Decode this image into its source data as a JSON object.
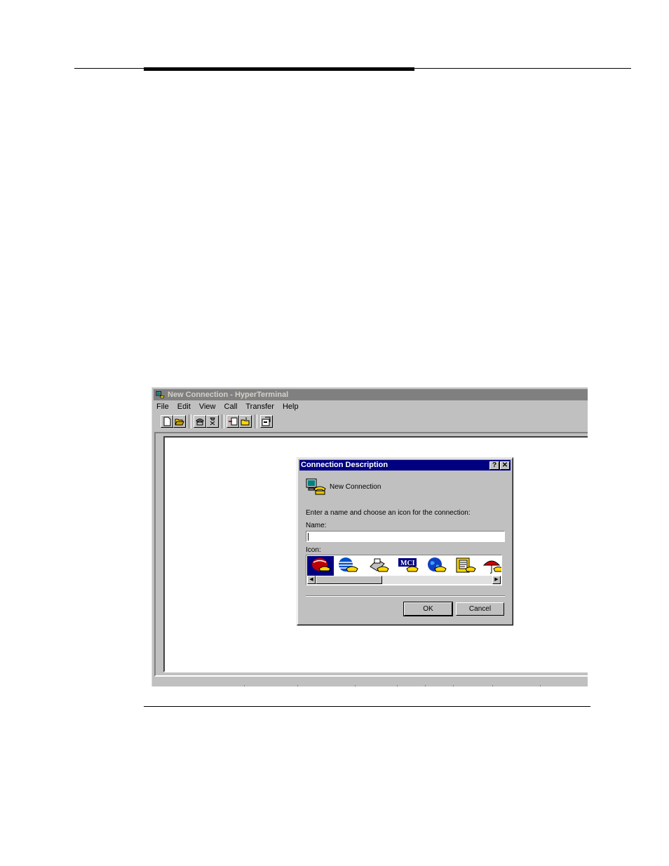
{
  "window": {
    "title": "New Connection - HyperTerminal",
    "menu": [
      "File",
      "Edit",
      "View",
      "Call",
      "Transfer",
      "Help"
    ],
    "toolbar_icons": [
      "new-icon",
      "open-icon",
      "connect-icon",
      "disconnect-icon",
      "send-icon",
      "receive-icon",
      "properties-icon"
    ]
  },
  "dialog": {
    "title": "Connection Description",
    "help_button": "?",
    "close_button": "✕",
    "connection_label": "New Connection",
    "prompt": "Enter a name and choose an icon for the connection:",
    "name_label": "Name:",
    "name_value": "",
    "icon_label": "Icon:",
    "icons": [
      "att-icon",
      "globe-phone-icon",
      "fax-icon",
      "mci-icon",
      "earth-phone-icon",
      "notebook-icon",
      "umbrella-icon"
    ],
    "ok_label": "OK",
    "cancel_label": "Cancel"
  }
}
